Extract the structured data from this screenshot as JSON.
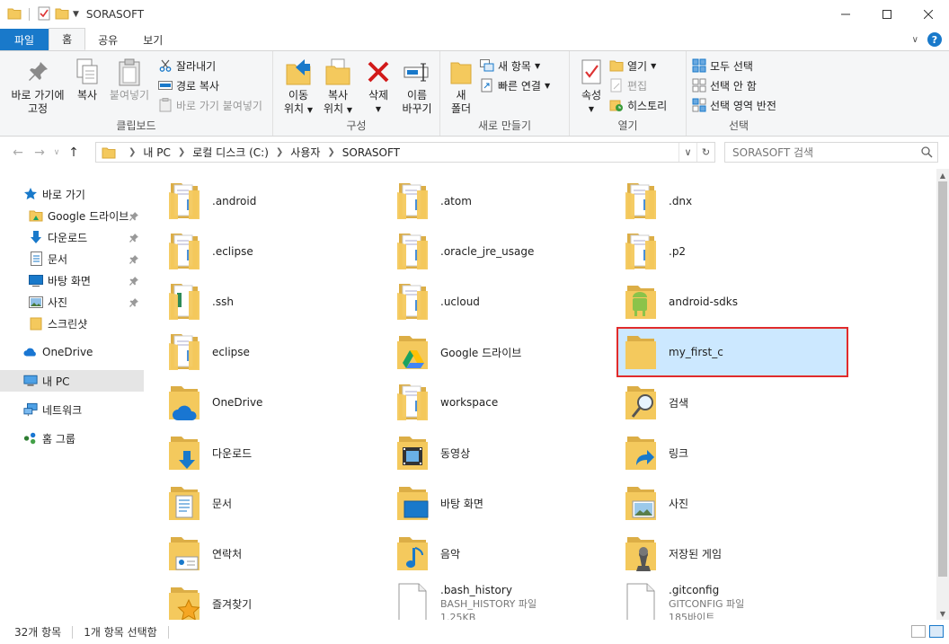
{
  "window": {
    "title": "SORASOFT"
  },
  "tabs": [
    {
      "label": "파일"
    },
    {
      "label": "홈"
    },
    {
      "label": "공유"
    },
    {
      "label": "보기"
    }
  ],
  "ribbon": {
    "clipboard": {
      "group_label": "클립보드",
      "pin": "바로 가기에\n고정",
      "pin_line1": "바로 가기에",
      "pin_line2": "고정",
      "copy": "복사",
      "paste": "붙여넣기",
      "cut": "잘라내기",
      "copy_path": "경로 복사",
      "paste_shortcut": "바로 가기 붙여넣기"
    },
    "organize": {
      "group_label": "구성",
      "move_line1": "이동",
      "move_line2": "위치",
      "copyto_line1": "복사",
      "copyto_line2": "위치",
      "delete": "삭제",
      "rename_line1": "이름",
      "rename_line2": "바꾸기"
    },
    "new": {
      "group_label": "새로 만들기",
      "new_folder_line1": "새",
      "new_folder_line2": "폴더",
      "new_item": "새 항목",
      "easy_access": "빠른 연결"
    },
    "open": {
      "group_label": "열기",
      "properties": "속성",
      "open": "열기",
      "edit": "편집",
      "history": "히스토리"
    },
    "select": {
      "group_label": "선택",
      "select_all": "모두 선택",
      "select_none": "선택 안 함",
      "invert": "선택 영역 반전"
    }
  },
  "address": {
    "crumbs": [
      "내 PC",
      "로컬 디스크 (C:)",
      "사용자",
      "SORASOFT"
    ],
    "search_placeholder": "SORASOFT 검색"
  },
  "nav": {
    "quick_access": "바로 가기",
    "items": [
      {
        "label": "Google 드라이브"
      },
      {
        "label": "다운로드"
      },
      {
        "label": "문서"
      },
      {
        "label": "바탕 화면"
      },
      {
        "label": "사진"
      },
      {
        "label": "스크린샷"
      }
    ],
    "onedrive": "OneDrive",
    "this_pc": "내 PC",
    "network": "네트워크",
    "homegroup": "홈 그룹"
  },
  "files": [
    {
      "name": ".android",
      "icon": "folder-doc"
    },
    {
      "name": ".atom",
      "icon": "folder-doc"
    },
    {
      "name": ".dnx",
      "icon": "folder-doc"
    },
    {
      "name": ".eclipse",
      "icon": "folder-doc"
    },
    {
      "name": ".oracle_jre_usage",
      "icon": "folder-doc"
    },
    {
      "name": ".p2",
      "icon": "folder-doc"
    },
    {
      "name": ".ssh",
      "icon": "folder-green"
    },
    {
      "name": ".ucloud",
      "icon": "folder-doc"
    },
    {
      "name": "android-sdks",
      "icon": "folder-android"
    },
    {
      "name": "eclipse",
      "icon": "folder-doc"
    },
    {
      "name": "Google 드라이브",
      "icon": "folder-gdrive"
    },
    {
      "name": "my_first_c",
      "icon": "folder",
      "selected": true
    },
    {
      "name": "OneDrive",
      "icon": "folder-onedrive"
    },
    {
      "name": "workspace",
      "icon": "folder-doc"
    },
    {
      "name": "검색",
      "icon": "folder-search"
    },
    {
      "name": "다운로드",
      "icon": "folder-download"
    },
    {
      "name": "동영상",
      "icon": "folder-video"
    },
    {
      "name": "링크",
      "icon": "folder-link"
    },
    {
      "name": "문서",
      "icon": "folder-documents"
    },
    {
      "name": "바탕 화면",
      "icon": "folder-desktop"
    },
    {
      "name": "사진",
      "icon": "folder-pictures"
    },
    {
      "name": "연락처",
      "icon": "folder-contacts"
    },
    {
      "name": "음악",
      "icon": "folder-music"
    },
    {
      "name": "저장된 게임",
      "icon": "folder-games"
    },
    {
      "name": "즐겨찾기",
      "icon": "folder-favorites"
    },
    {
      "name": ".bash_history",
      "icon": "file",
      "type": "BASH_HISTORY 파일",
      "size": "1.25KB"
    },
    {
      "name": ".gitconfig",
      "icon": "file",
      "type": "GITCONFIG 파일",
      "size": "185바이트"
    }
  ],
  "status": {
    "count": "32개 항목",
    "selected": "1개 항목 선택함"
  },
  "colors": {
    "accent": "#1979ca",
    "folder": "#f4c95d",
    "selection": "#cce8ff",
    "highlight_box": "#e12b2b"
  }
}
